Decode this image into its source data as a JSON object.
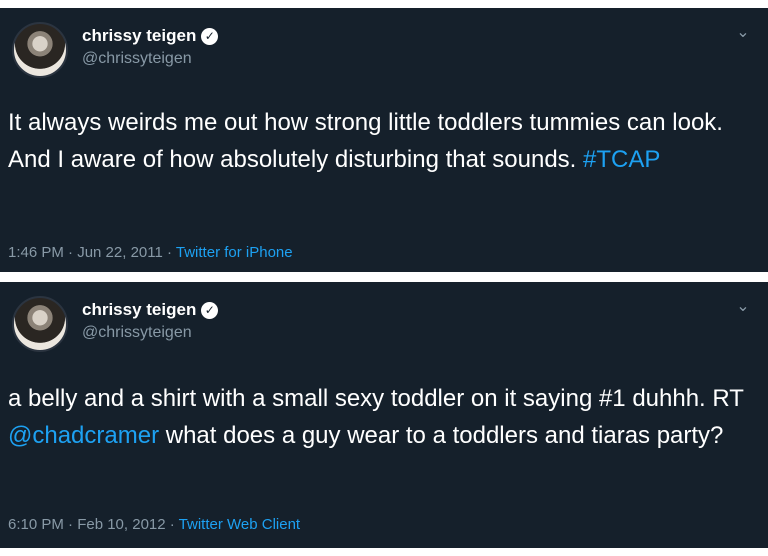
{
  "tweets": [
    {
      "author_name": "chrissy teigen",
      "author_handle": "@chrissyteigen",
      "text_before": "It always weirds me out how strong little toddlers tummies can look. And I  aware of how absolutely disturbing that sounds. ",
      "hashtag": "#TCAP",
      "text_after": "",
      "timestamp": "1:46 PM · Jun 22, 2011 · ",
      "source": "Twitter for iPhone"
    },
    {
      "author_name": "chrissy teigen",
      "author_handle": "@chrissyteigen",
      "text_before": "a belly and a shirt with a small sexy toddler on it saying #1 duhhh. RT ",
      "mention": "@chadcramer",
      "text_after": "  what does a guy wear to a toddlers and tiaras party?",
      "timestamp": "6:10 PM · Feb 10, 2012 · ",
      "source": "Twitter Web Client"
    }
  ],
  "icons": {
    "verified": "verified-badge-icon",
    "more": "chevron-down-icon"
  },
  "colors": {
    "background": "#15202b",
    "link": "#1da1f2",
    "secondary_text": "#8899a6"
  }
}
